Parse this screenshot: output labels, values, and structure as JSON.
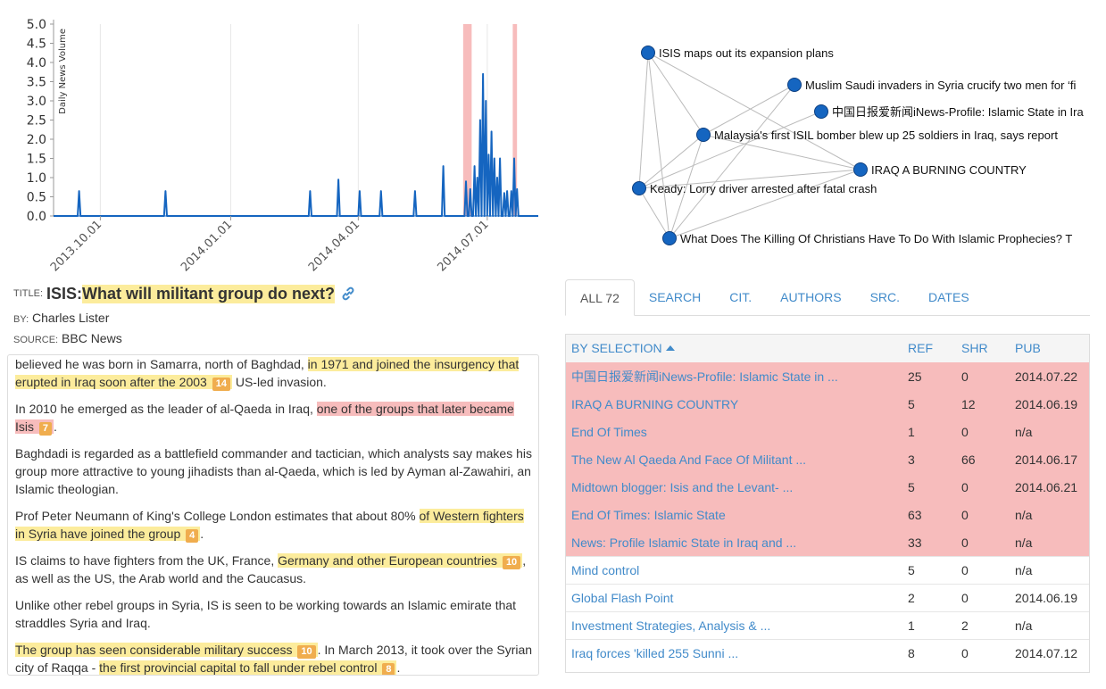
{
  "chart_data": {
    "type": "line",
    "ylabel": "Daily News Volume",
    "ylim": [
      0,
      5
    ],
    "y_ticks": [
      "0.0",
      "0.5",
      "1.0",
      "1.5",
      "2.0",
      "2.5",
      "3.0",
      "3.5",
      "4.0",
      "4.5",
      "5.0"
    ],
    "x_tick_labels": [
      "2013.10.01",
      "2014.01.01",
      "2014.04.01",
      "2014.07.01"
    ],
    "x_tick_values": [
      "2013-10-01",
      "2014-01-01",
      "2014-04-01",
      "2014-07-01"
    ],
    "x_domain": [
      "2013-08-29",
      "2014-08-06"
    ],
    "series": [
      {
        "color": "#1565c0",
        "points": [
          [
            "2013-09-16",
            0.65
          ],
          [
            "2013-11-16",
            0.65
          ],
          [
            "2014-02-26",
            0.65
          ],
          [
            "2014-03-18",
            0.95
          ],
          [
            "2014-04-02",
            0.65
          ],
          [
            "2014-04-17",
            0.65
          ],
          [
            "2014-05-11",
            0.65
          ],
          [
            "2014-05-31",
            1.3
          ],
          [
            "2014-06-16",
            0.9
          ],
          [
            "2014-06-19",
            0.7
          ],
          [
            "2014-06-22",
            1.3
          ],
          [
            "2014-06-24",
            1.0
          ],
          [
            "2014-06-26",
            2.5
          ],
          [
            "2014-06-28",
            3.7
          ],
          [
            "2014-06-30",
            3.0
          ],
          [
            "2014-07-02",
            1.6
          ],
          [
            "2014-07-04",
            2.2
          ],
          [
            "2014-07-06",
            1.5
          ],
          [
            "2014-07-08",
            1.0
          ],
          [
            "2014-07-10",
            1.5
          ],
          [
            "2014-07-13",
            0.6
          ],
          [
            "2014-07-15",
            0.65
          ],
          [
            "2014-07-18",
            0.65
          ],
          [
            "2014-07-20",
            1.5
          ],
          [
            "2014-07-22",
            0.7
          ]
        ]
      }
    ],
    "highlight_ranges": [
      [
        "2014-06-14",
        "2014-06-20"
      ],
      [
        "2014-07-19",
        "2014-07-22"
      ]
    ],
    "highlight_color": "#f7bcbc"
  },
  "network": {
    "node_color": "#1565c0",
    "nodes": [
      {
        "id": "n0",
        "label": "ISIS maps out its expansion plans"
      },
      {
        "id": "n1",
        "label": "Muslim Saudi invaders in Syria crucify two men for ‘fi"
      },
      {
        "id": "n2",
        "label": "中国日报爱新闻iNews-Profile: Islamic State in Ira"
      },
      {
        "id": "n3",
        "label": "Malaysia's first ISIL bomber blew up 25 soldiers in Iraq, says report"
      },
      {
        "id": "n4",
        "label": "IRAQ A BURNING COUNTRY"
      },
      {
        "id": "n5",
        "label": "Keady: Lorry driver arrested after fatal crash"
      },
      {
        "id": "n6",
        "label": "What Does The Killing Of Christians Have To Do With Islamic Prophecies? T"
      }
    ]
  },
  "article": {
    "title_label": "TITLE:",
    "title_prefix": "ISIS:",
    "title_highlight": "What will militant group do next?",
    "by_label": "BY:",
    "author": "Charles Lister",
    "source_label": "SOURCE:",
    "source": "BBC News",
    "paragraphs": [
      {
        "segments": [
          {
            "text": "believed he was born in Samarra, north of Baghdad, "
          },
          {
            "text": "in 1971 and joined the insurgency that erupted in Iraq soon after the 2003",
            "hl": "yellow",
            "badge": "14"
          },
          {
            "text": " US-led invasion."
          }
        ]
      },
      {
        "segments": [
          {
            "text": "In 2010 he emerged as the leader of al-Qaeda in Iraq, "
          },
          {
            "text": "one of the groups that later became Isis",
            "hl": "red",
            "badge": "7"
          },
          {
            "text": "."
          }
        ]
      },
      {
        "segments": [
          {
            "text": "Baghdadi is regarded as a battlefield commander and tactician, which analysts say makes his group more attractive to young jihadists than al-Qaeda, which is led by Ayman al-Zawahiri, an Islamic theologian."
          }
        ]
      },
      {
        "segments": [
          {
            "text": "Prof Peter Neumann of King's College London estimates that about 80% "
          },
          {
            "text": "of Western fighters in Syria have joined the group",
            "hl": "yellow",
            "badge": "4"
          },
          {
            "text": "."
          }
        ]
      },
      {
        "segments": [
          {
            "text": "IS claims to have fighters from the UK, France, "
          },
          {
            "text": "Germany and other European countries",
            "hl": "yellow",
            "badge": "10"
          },
          {
            "text": ", as well as the US, the Arab world and the Caucasus."
          }
        ]
      },
      {
        "segments": [
          {
            "text": "Unlike other rebel groups in Syria, IS is seen to be working towards an Islamic emirate that straddles Syria and Iraq."
          }
        ]
      },
      {
        "segments": [
          {
            "text": "The group has seen considerable military success",
            "hl": "yellow",
            "badge": "10"
          },
          {
            "text": ". In March 2013, it took over the Syrian city of Raqqa - "
          },
          {
            "text": "the first provincial capital to fall under rebel control",
            "hl": "yellow",
            "badge": "8"
          },
          {
            "text": "."
          }
        ]
      }
    ]
  },
  "tabs": [
    "ALL 72",
    "SEARCH",
    "CIT.",
    "AUTHORS",
    "SRC.",
    "DATES"
  ],
  "doc_table": {
    "headers": {
      "title": "BY SELECTION",
      "ref": "REF",
      "shr": "SHR",
      "pub": "PUB"
    },
    "rows": [
      {
        "title": "中国日报爱新闻iNews-Profile: Islamic State in ...",
        "ref": "25",
        "shr": "0",
        "pub": "2014.07.22",
        "selected": true
      },
      {
        "title": "IRAQ A BURNING COUNTRY",
        "ref": "5",
        "shr": "12",
        "pub": "2014.06.19",
        "selected": true
      },
      {
        "title": "End Of Times",
        "ref": "1",
        "shr": "0",
        "pub": "n/a",
        "selected": true
      },
      {
        "title": "The New Al Qaeda And Face Of Militant ...",
        "ref": "3",
        "shr": "66",
        "pub": "2014.06.17",
        "selected": true
      },
      {
        "title": "Midtown blogger: Isis and the Levant- ...",
        "ref": "5",
        "shr": "0",
        "pub": "2014.06.21",
        "selected": true
      },
      {
        "title": "End Of Times: Islamic State",
        "ref": "63",
        "shr": "0",
        "pub": "n/a",
        "selected": true
      },
      {
        "title": "News: Profile Islamic State in Iraq and ...",
        "ref": "33",
        "shr": "0",
        "pub": "n/a",
        "selected": true
      },
      {
        "title": "Mind control",
        "ref": "5",
        "shr": "0",
        "pub": "n/a",
        "selected": false
      },
      {
        "title": "Global Flash Point",
        "ref": "2",
        "shr": "0",
        "pub": "2014.06.19",
        "selected": false
      },
      {
        "title": "Investment Strategies, Analysis & ...",
        "ref": "1",
        "shr": "2",
        "pub": "n/a",
        "selected": false
      },
      {
        "title": "Iraq forces 'killed 255 Sunni ...",
        "ref": "8",
        "shr": "0",
        "pub": "2014.07.12",
        "selected": false
      }
    ]
  }
}
